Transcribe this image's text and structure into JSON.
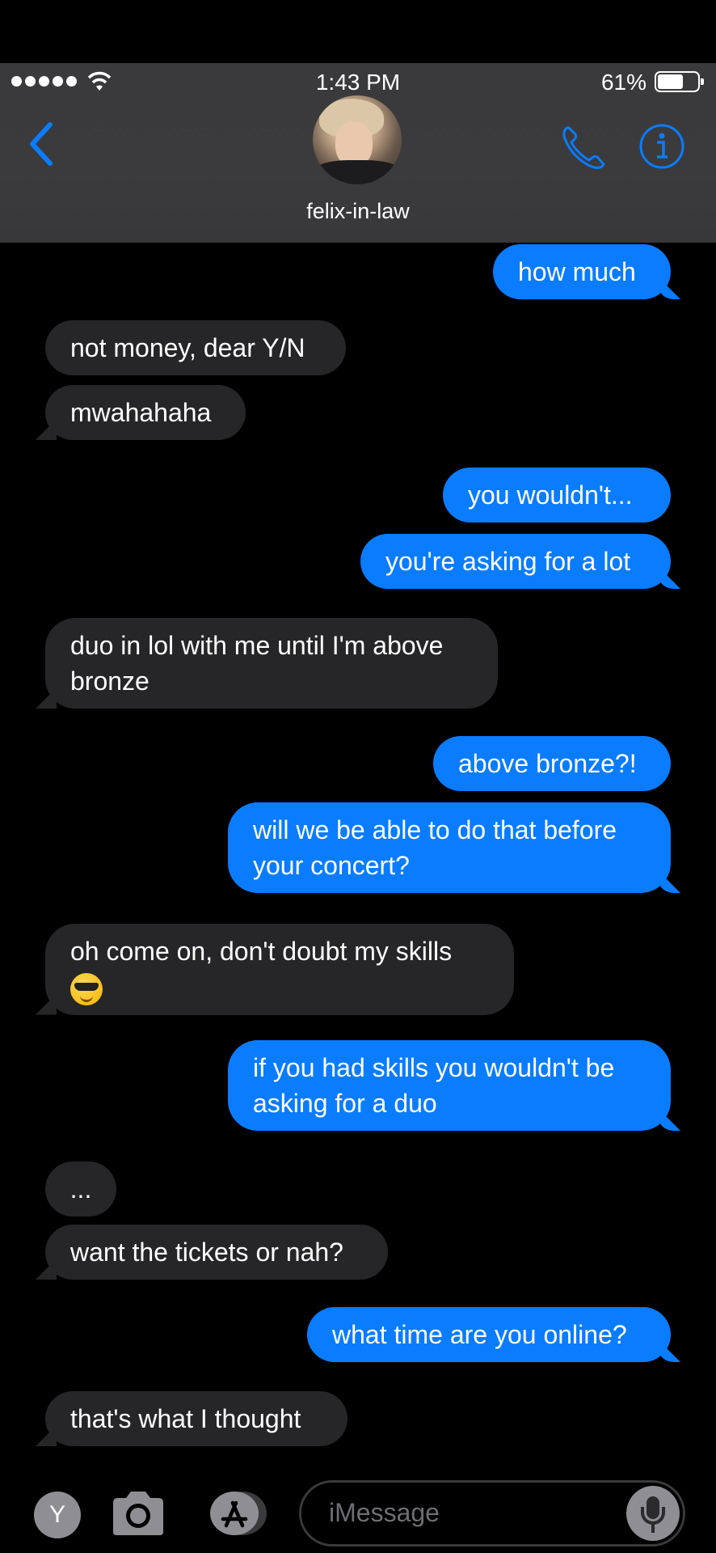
{
  "status_bar": {
    "time": "1:43 PM",
    "battery_percent": "61%",
    "battery_level": 0.61
  },
  "header": {
    "contact_name": "felix-in-law",
    "accent_color": "#0a7cff"
  },
  "messages": [
    {
      "from": "me",
      "text": "how much"
    },
    {
      "from": "them",
      "text": "not money, dear Y/N"
    },
    {
      "from": "them",
      "text": "mwahahaha"
    },
    {
      "from": "me",
      "text": "you wouldn't..."
    },
    {
      "from": "me",
      "text": "you're asking for a lot"
    },
    {
      "from": "them",
      "text": "duo in lol with me until I'm above bronze"
    },
    {
      "from": "me",
      "text": "above bronze?!"
    },
    {
      "from": "me",
      "text": "will we be able to do that before your concert?"
    },
    {
      "from": "them",
      "text": "oh come on, don't doubt my skills",
      "emoji": "sunglasses-emoji"
    },
    {
      "from": "me",
      "text": "if you had skills you wouldn't be asking for a duo"
    },
    {
      "from": "them",
      "text": "..."
    },
    {
      "from": "them",
      "text": "want the tickets or nah?"
    },
    {
      "from": "me",
      "text": "what time are you online?"
    },
    {
      "from": "them",
      "text": "that's what I thought"
    }
  ],
  "composer": {
    "app_initial": "Y",
    "placeholder": "iMessage"
  }
}
